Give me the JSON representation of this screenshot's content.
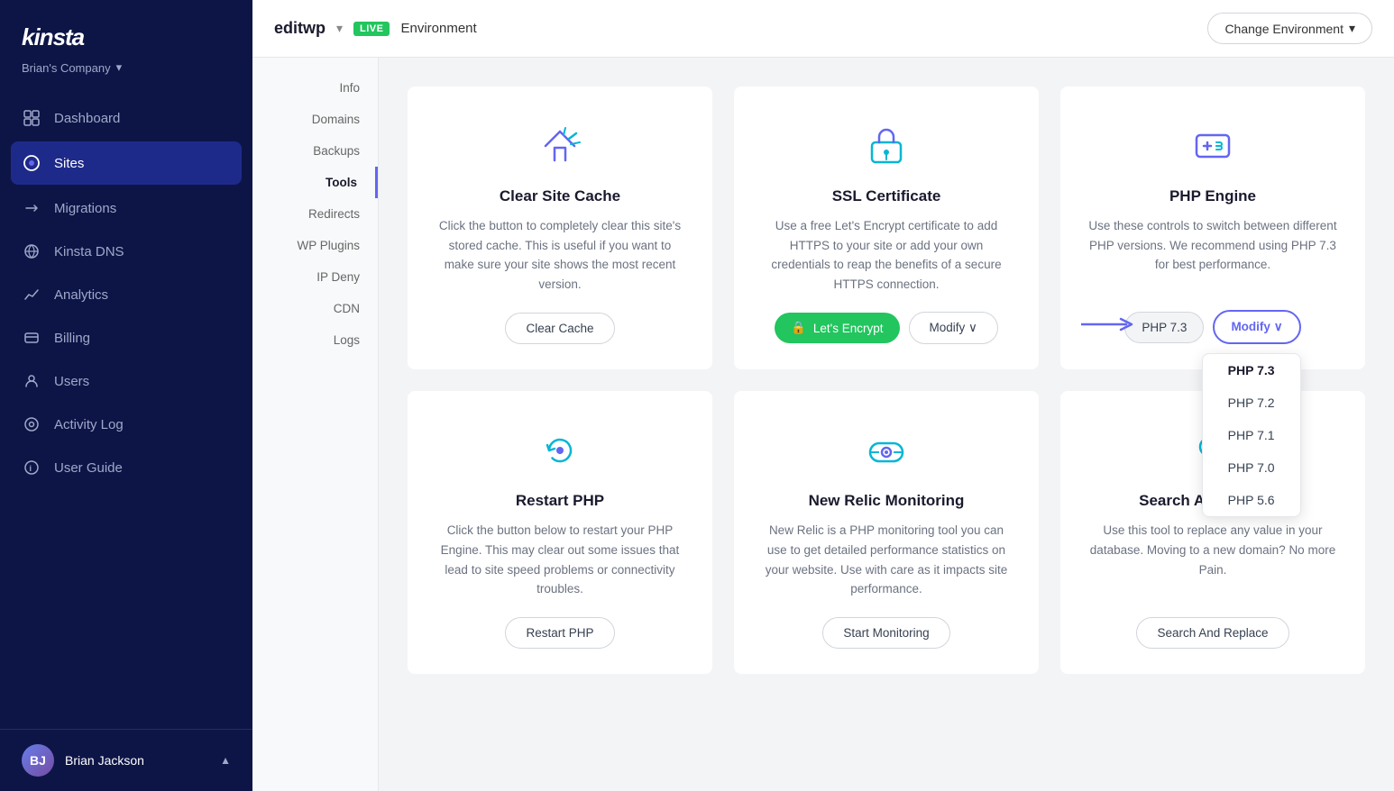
{
  "sidebar": {
    "logo": "kinsta",
    "company": "Brian's Company",
    "company_chevron": "▾",
    "nav_items": [
      {
        "id": "dashboard",
        "label": "Dashboard",
        "icon": "⊙",
        "active": false
      },
      {
        "id": "sites",
        "label": "Sites",
        "icon": "◉",
        "active": true
      },
      {
        "id": "migrations",
        "label": "Migrations",
        "icon": "➤",
        "active": false
      },
      {
        "id": "kinsta-dns",
        "label": "Kinsta DNS",
        "icon": "≈",
        "active": false
      },
      {
        "id": "analytics",
        "label": "Analytics",
        "icon": "↗",
        "active": false
      },
      {
        "id": "billing",
        "label": "Billing",
        "icon": "⊟",
        "active": false
      },
      {
        "id": "users",
        "label": "Users",
        "icon": "⊕",
        "active": false
      },
      {
        "id": "activity-log",
        "label": "Activity Log",
        "icon": "◎",
        "active": false
      },
      {
        "id": "user-guide",
        "label": "User Guide",
        "icon": "ⓘ",
        "active": false
      }
    ],
    "user": {
      "name": "Brian Jackson",
      "chevron": "▲"
    }
  },
  "topbar": {
    "site_name": "editwp",
    "chevron": "▾",
    "env_badge": "LIVE",
    "env_label": "Environment",
    "change_env_label": "Change Environment",
    "change_env_chevron": "▾"
  },
  "sub_nav": {
    "items": [
      {
        "label": "Info",
        "active": false
      },
      {
        "label": "Domains",
        "active": false
      },
      {
        "label": "Backups",
        "active": false
      },
      {
        "label": "Tools",
        "active": true
      },
      {
        "label": "Redirects",
        "active": false
      },
      {
        "label": "WP Plugins",
        "active": false
      },
      {
        "label": "IP Deny",
        "active": false
      },
      {
        "label": "CDN",
        "active": false
      },
      {
        "label": "Logs",
        "active": false
      }
    ]
  },
  "tools": {
    "cards": [
      {
        "id": "clear-cache",
        "title": "Clear Site Cache",
        "desc": "Click the button to completely clear this site's stored cache. This is useful if you want to make sure your site shows the most recent version.",
        "btn_label": "Clear Cache",
        "btn_type": "outline"
      },
      {
        "id": "ssl",
        "title": "SSL Certificate",
        "desc": "Use a free Let's Encrypt certificate to add HTTPS to your site or add your own credentials to reap the benefits of a secure HTTPS connection.",
        "btn_label": "Let's Encrypt",
        "btn_label2": "Modify",
        "btn_type": "split"
      },
      {
        "id": "php-engine",
        "title": "PHP Engine",
        "desc": "Use these controls to switch between different PHP versions. We recommend using PHP 7.3 for best performance.",
        "current_version": "PHP 7.3",
        "btn_label": "Modify",
        "btn_type": "php"
      },
      {
        "id": "restart-php",
        "title": "Restart PHP",
        "desc": "Click the button below to restart your PHP Engine. This may clear out some issues that lead to site speed problems or connectivity troubles.",
        "btn_label": "Restart PHP",
        "btn_type": "outline"
      },
      {
        "id": "new-relic",
        "title": "New Relic Monitoring",
        "desc": "New Relic is a PHP monitoring tool you can use to get detailed performance statistics on your website. Use with care as it impacts site performance.",
        "btn_label": "Start Monitoring",
        "btn_type": "outline"
      },
      {
        "id": "search-replace",
        "title": "Search And Replace",
        "desc": "Use this tool to replace any value in your database. Moving to a new domain? No more Pain.",
        "btn_label": "Search And Replace",
        "btn_type": "outline"
      }
    ],
    "php_versions": [
      "PHP 7.3",
      "PHP 7.2",
      "PHP 7.1",
      "PHP 7.0",
      "PHP 5.6"
    ]
  },
  "colors": {
    "sidebar_bg": "#0d1547",
    "active_nav": "#1e2a8a",
    "accent": "#6366f1",
    "green": "#22c55e"
  }
}
